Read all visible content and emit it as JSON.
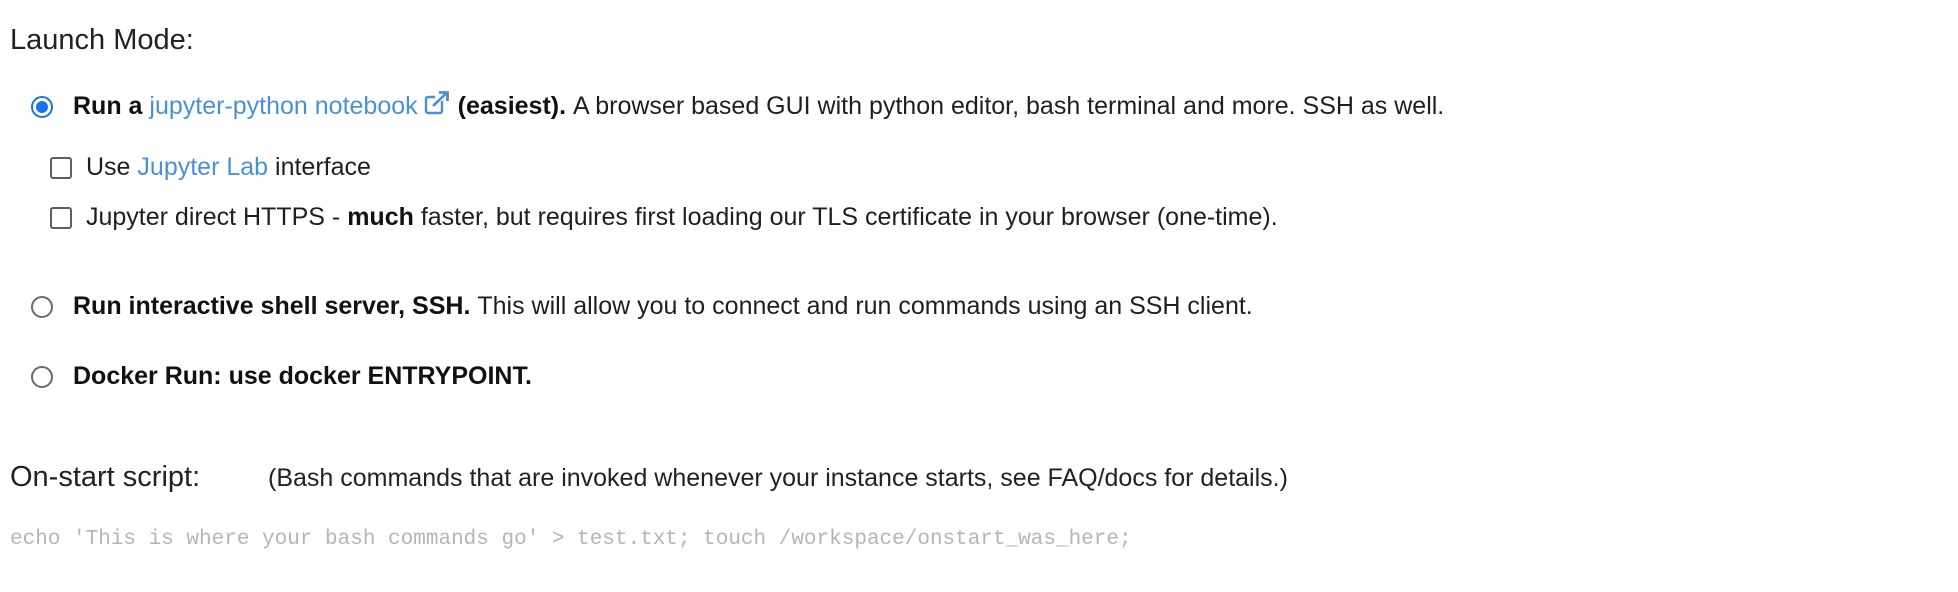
{
  "launch_mode": {
    "label": "Launch Mode:",
    "options": {
      "jupyter": {
        "selected": true,
        "prefix": "Run a",
        "link_text": "jupyter-python notebook",
        "suffix_bold": "(easiest).",
        "description": "A browser based GUI with python editor, bash terminal and more. SSH as well."
      },
      "ssh": {
        "selected": false,
        "bold": "Run interactive shell server, SSH.",
        "description": "This will allow you to connect and run commands using an SSH client."
      },
      "docker": {
        "selected": false,
        "bold": "Docker Run: use docker ENTRYPOINT."
      }
    },
    "jupyter_lab": {
      "checked": false,
      "prefix": "Use",
      "link_text": "Jupyter Lab",
      "suffix": "interface"
    },
    "jupyter_https": {
      "checked": false,
      "prefix": "Jupyter direct HTTPS -",
      "bold": "much",
      "suffix": "faster, but requires first loading our TLS certificate in your browser (one-time)."
    }
  },
  "onstart": {
    "label": "On-start script:",
    "description": "(Bash commands that are invoked whenever your instance starts, see FAQ/docs for details.)",
    "value": "",
    "placeholder": "echo 'This is where your bash commands go' > test.txt; touch /workspace/onstart_was_here;"
  },
  "colors": {
    "accent": "#1a73e8",
    "link": "#4a90d9",
    "placeholder": "#b5b5b5"
  },
  "icons": {
    "external_link": "external-link-icon"
  }
}
